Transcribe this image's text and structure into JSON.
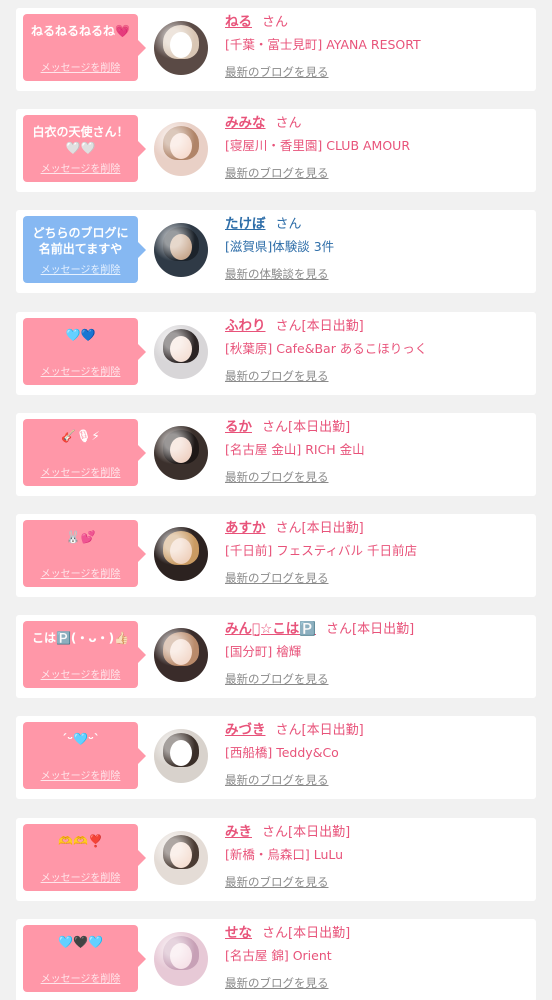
{
  "colors": {
    "bubble_pink": "#ff97a8",
    "bubble_blue": "#86b8f2",
    "name_pink": "#e8537a",
    "name_blue": "#2d6da8",
    "link_gray": "#8a8a8a",
    "page_bg": "#f1f1f1"
  },
  "messages": [
    {
      "message": "ねるねるねるね💗",
      "delete_label": "メッセージを削除",
      "name": "ねる",
      "honorific": "さん",
      "status": "",
      "location": "[千葉・富士見町] AYANA RESORT",
      "link": "最新のブログを見る",
      "theme": "pink",
      "avatar": {
        "bg": "#5a4a45",
        "hair": "#d9c6b4",
        "face": "#ffffff"
      }
    },
    {
      "message": "白衣の天使さん！\n🤍🤍",
      "delete_label": "メッセージを削除",
      "name": "みみな",
      "honorific": "さん",
      "status": "",
      "location": "[寝屋川・香里園] CLUB AMOUR",
      "link": "最新のブログを見る",
      "theme": "pink",
      "avatar": {
        "bg": "#e9d0c6",
        "hair": "#b08468",
        "face": "#f6dcd0"
      }
    },
    {
      "message": "どちらのブログに\n名前出てますや",
      "delete_label": "メッセージを削除",
      "name": "たけぼ",
      "honorific": "さん",
      "status": "",
      "location": "[滋賀県]体験談 3件",
      "link": "最新の体験談を見る",
      "theme": "blue",
      "avatar": {
        "bg": "#2f3a46",
        "hair": "#1c232b",
        "face": "#c9a98f"
      }
    },
    {
      "message": "🩵💙",
      "delete_label": "メッセージを削除",
      "name": "ふわり",
      "honorific": "さん",
      "status": "[本日出勤]",
      "location": "[秋葉原] Cafe&Bar あるこほりっく",
      "link": "最新のブログを見る",
      "theme": "pink",
      "avatar": {
        "bg": "#d8d6d8",
        "hair": "#2b2424",
        "face": "#f4e0d6"
      }
    },
    {
      "message": "🎸🎙⚡",
      "delete_label": "メッセージを削除",
      "name": "るか",
      "honorific": "さん",
      "status": "[本日出勤]",
      "location": "[名古屋 金山] RICH 金山",
      "link": "最新のブログを見る",
      "theme": "pink",
      "avatar": {
        "bg": "#3b302c",
        "hair": "#1e1817",
        "face": "#efd2c4"
      }
    },
    {
      "message": "🐰💕",
      "delete_label": "メッセージを削除",
      "name": "あすか",
      "honorific": "さん",
      "status": "[本日出勤]",
      "location": "[千日前] フェスティバル 千日前店",
      "link": "最新のブログを見る",
      "theme": "pink",
      "avatar": {
        "bg": "#2c2220",
        "hair": "#c99a62",
        "face": "#efd1bd"
      }
    },
    {
      "message": "こは🅿️(・ᴗ・)👍🏻",
      "delete_label": "メッセージを削除",
      "name": "みんꪔ̤̮☆こは🅿️",
      "honorific": "さん",
      "status": "[本日出勤]",
      "location": "[国分町] 檜輝",
      "link": "最新のブログを見る",
      "theme": "pink",
      "avatar": {
        "bg": "#3a2c2a",
        "hair": "#b98a6a",
        "face": "#f3d9cb"
      }
    },
    {
      "message": "ˊᵕ🩵ᵕˋ",
      "delete_label": "メッセージを削除",
      "name": "みづき",
      "honorific": "さん",
      "status": "[本日出勤]",
      "location": "[西船橋] Teddy&Co",
      "link": "最新のブログを見る",
      "theme": "pink",
      "avatar": {
        "bg": "#d8d2cc",
        "hair": "#3a2e28",
        "face": "#ffffff"
      }
    },
    {
      "message": "🫶🫶❣️",
      "delete_label": "メッセージを削除",
      "name": "みき",
      "honorific": "さん",
      "status": "[本日出勤]",
      "location": "[新橋・烏森口] LuLu",
      "link": "最新のブログを見る",
      "theme": "pink",
      "avatar": {
        "bg": "#e4dcd6",
        "hair": "#4a3b33",
        "face": "#f5dfd3"
      }
    },
    {
      "message": "🩵🖤🩵",
      "delete_label": "メッセージを削除",
      "name": "せな",
      "honorific": "さん",
      "status": "[本日出勤]",
      "location": "[名古屋 錦] Orient",
      "link": "最新のブログを見る",
      "theme": "pink",
      "avatar": {
        "bg": "#e7c9d6",
        "hair": "#c7a0b6",
        "face": "#f6e2e8"
      }
    }
  ]
}
